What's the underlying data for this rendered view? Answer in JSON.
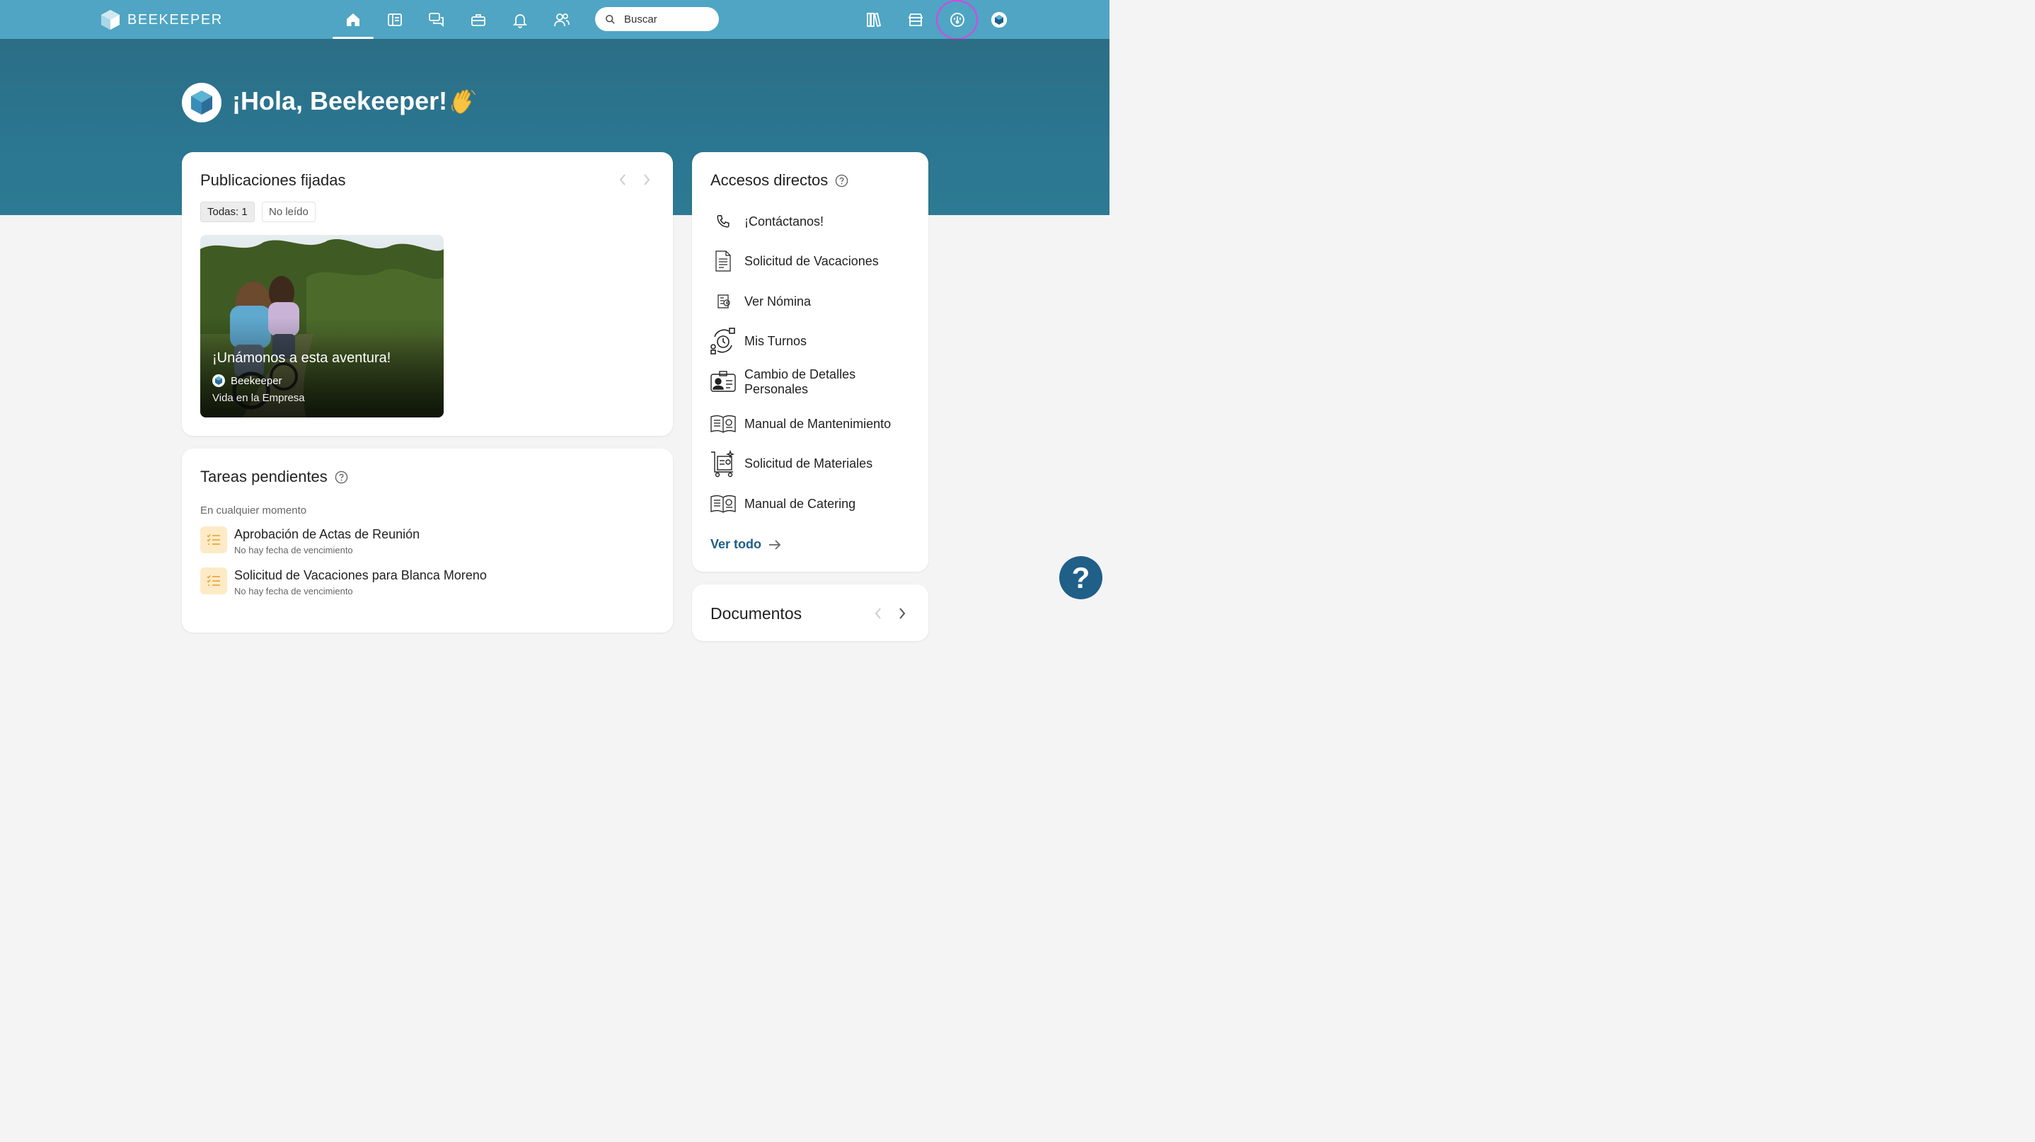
{
  "app": {
    "brand": "BEEKEEPER"
  },
  "nav": {
    "search_placeholder": "Buscar",
    "icons": [
      "home-icon",
      "news-icon",
      "chat-icon",
      "toolbox-icon",
      "bell-icon",
      "people-icon",
      "library-icon",
      "store-icon",
      "dashboard-icon",
      "profile-icon"
    ]
  },
  "hero": {
    "greeting": "¡Hola, Beekeeper!",
    "emoji": "👋"
  },
  "pinned": {
    "title": "Publicaciones fijadas",
    "filters": {
      "all": "Todas: 1",
      "unread": "No leído"
    },
    "post": {
      "title": "¡Unámonos a esta aventura!",
      "author": "Beekeeper",
      "category": "Vida en la Empresa"
    }
  },
  "tasks": {
    "title": "Tareas pendientes",
    "subtitle": "En cualquier momento",
    "items": [
      {
        "title": "Aprobación de Actas de Reunión",
        "due": "No hay fecha de vencimiento"
      },
      {
        "title": "Solicitud de Vacaciones para Blanca Moreno",
        "due": "No hay fecha de vencimiento"
      }
    ]
  },
  "shortcuts": {
    "title": "Accesos directos",
    "items": [
      {
        "label": "¡Contáctanos!",
        "icon": "phone-icon"
      },
      {
        "label": "Solicitud de Vacaciones",
        "icon": "document-icon"
      },
      {
        "label": "Ver Nómina",
        "icon": "payroll-icon"
      },
      {
        "label": "Mis Turnos",
        "icon": "shifts-icon"
      },
      {
        "label": "Cambio de Detalles Personales",
        "icon": "id-card-icon"
      },
      {
        "label": "Manual de Mantenimiento",
        "icon": "manual-icon"
      },
      {
        "label": "Solicitud de Materiales",
        "icon": "materials-cart-icon"
      },
      {
        "label": "Manual de Catering",
        "icon": "manual-icon"
      }
    ],
    "see_all": "Ver todo"
  },
  "documents": {
    "title": "Documentos"
  },
  "help_fab": "?",
  "colors": {
    "topbar": "#4fa5c3",
    "hero": "#2b7691",
    "accent": "#1f5f88",
    "task_icon_bg": "#fdebc7",
    "highlight_ring": "#e040e0"
  }
}
